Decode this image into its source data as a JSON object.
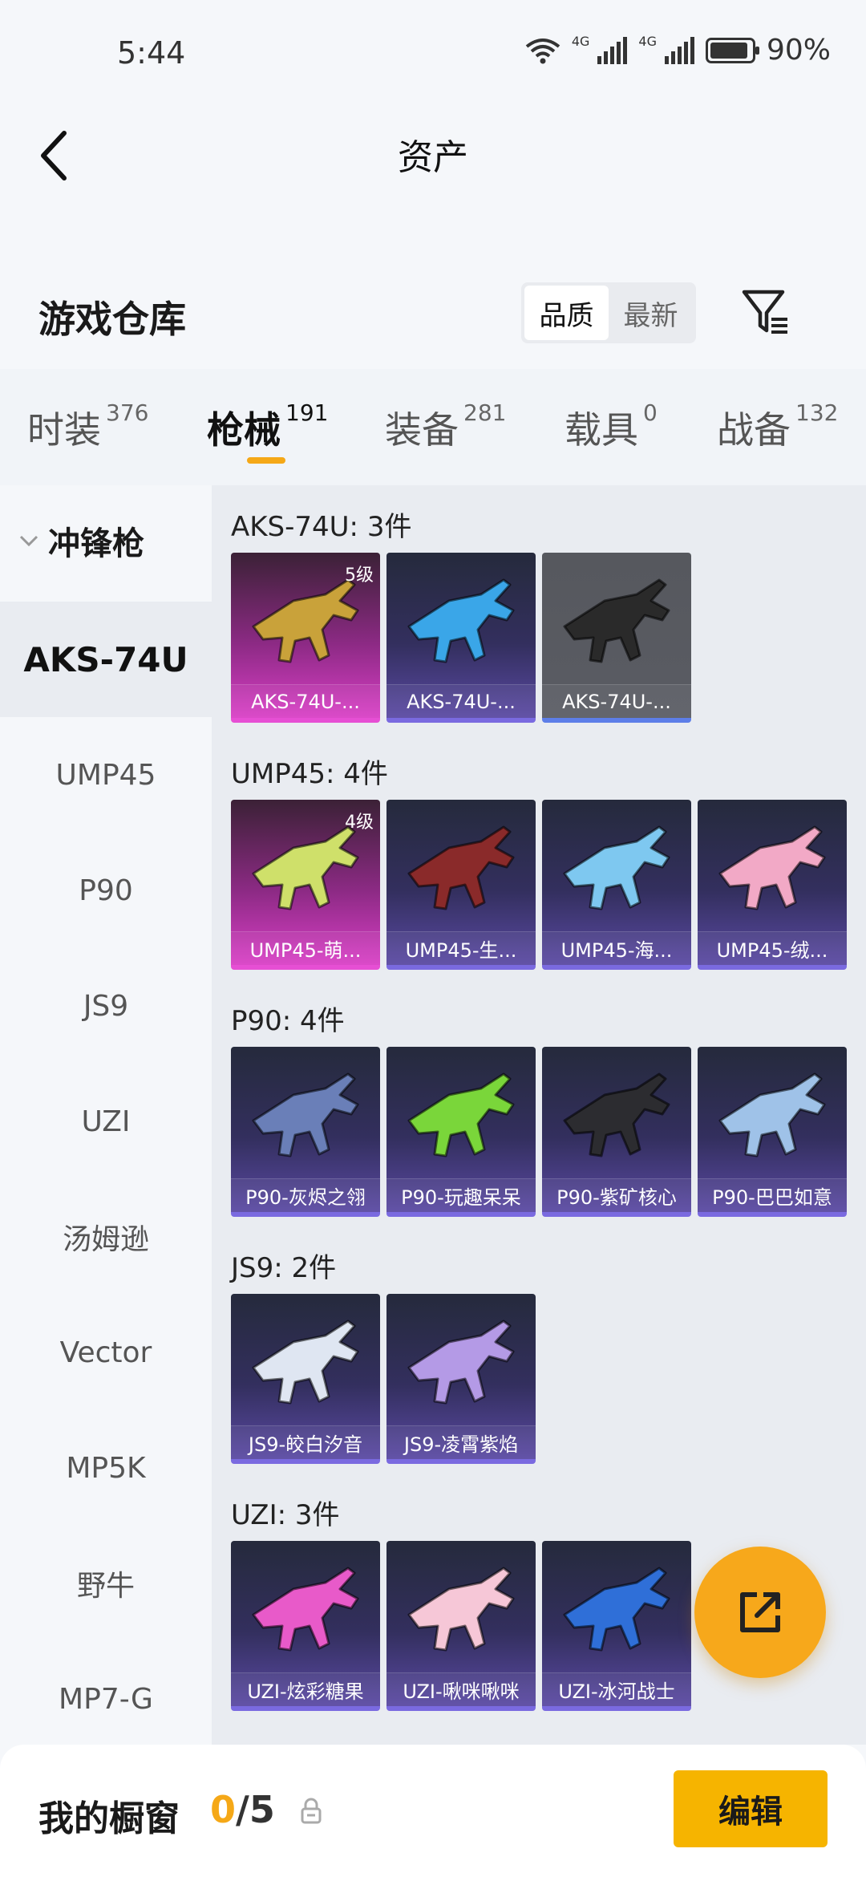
{
  "status_bar": {
    "time": "5:44",
    "battery": "90%",
    "net1": "4G",
    "net2": "4G"
  },
  "header": {
    "title": "资产"
  },
  "warehouse": {
    "title": "游戏仓库",
    "sort_options": [
      "品质",
      "最新"
    ],
    "active_sort": "品质"
  },
  "category_tabs": [
    {
      "label": "时装",
      "count": "376"
    },
    {
      "label": "枪械",
      "count": "191",
      "active": true
    },
    {
      "label": "装备",
      "count": "281"
    },
    {
      "label": "载具",
      "count": "0"
    },
    {
      "label": "战备",
      "count": "132"
    }
  ],
  "sidebar": {
    "group": "冲锋枪",
    "items": [
      "AKS-74U",
      "UMP45",
      "P90",
      "JS9",
      "UZI",
      "汤姆逊",
      "Vector",
      "MP5K",
      "野牛",
      "MP7-G"
    ],
    "active": "AKS-74U"
  },
  "sections": [
    {
      "title": "AKS-74U: 3件",
      "items": [
        {
          "name": "AKS-74U-...",
          "level": "5级",
          "style": "pink",
          "color": "#c9a23a"
        },
        {
          "name": "AKS-74U-...",
          "level": "",
          "style": "purple",
          "color": "#3aa6e8"
        },
        {
          "name": "AKS-74U-...",
          "level": "",
          "style": "grey",
          "color": "#2a2a2a"
        }
      ]
    },
    {
      "title": "UMP45: 4件",
      "items": [
        {
          "name": "UMP45-萌...",
          "level": "4级",
          "style": "pink",
          "color": "#cfe06a"
        },
        {
          "name": "UMP45-生...",
          "level": "",
          "style": "purple",
          "color": "#8a2a2a"
        },
        {
          "name": "UMP45-海...",
          "level": "",
          "style": "purple",
          "color": "#7ec8f0"
        },
        {
          "name": "UMP45-绒...",
          "level": "",
          "style": "purple",
          "color": "#f2a9c6"
        }
      ]
    },
    {
      "title": "P90: 4件",
      "items": [
        {
          "name": "P90-灰烬之翎",
          "level": "",
          "style": "purple",
          "color": "#6a7fb8"
        },
        {
          "name": "P90-玩趣呆呆",
          "level": "",
          "style": "purple",
          "color": "#7ad63a"
        },
        {
          "name": "P90-紫矿核心",
          "level": "",
          "style": "purple",
          "color": "#2c2c30"
        },
        {
          "name": "P90-巴巴如意",
          "level": "",
          "style": "purple",
          "color": "#9fc2e8"
        }
      ]
    },
    {
      "title": "JS9: 2件",
      "items": [
        {
          "name": "JS9-皎白汐音",
          "level": "",
          "style": "purple",
          "color": "#dfe6f2"
        },
        {
          "name": "JS9-凌霄紫焰",
          "level": "",
          "style": "purple",
          "color": "#b49ae6"
        }
      ]
    },
    {
      "title": "UZI: 3件",
      "items": [
        {
          "name": "UZI-炫彩糖果",
          "level": "",
          "style": "purple",
          "color": "#e85ac9"
        },
        {
          "name": "UZI-啾咪啾咪",
          "level": "",
          "style": "purple",
          "color": "#f6c7d7"
        },
        {
          "name": "UZI-冰河战士",
          "level": "",
          "style": "purple",
          "color": "#2f6fd8"
        }
      ]
    }
  ],
  "bottom_bar": {
    "label": "我的橱窗",
    "current": "0",
    "total": "/5",
    "edit_label": "编辑"
  }
}
